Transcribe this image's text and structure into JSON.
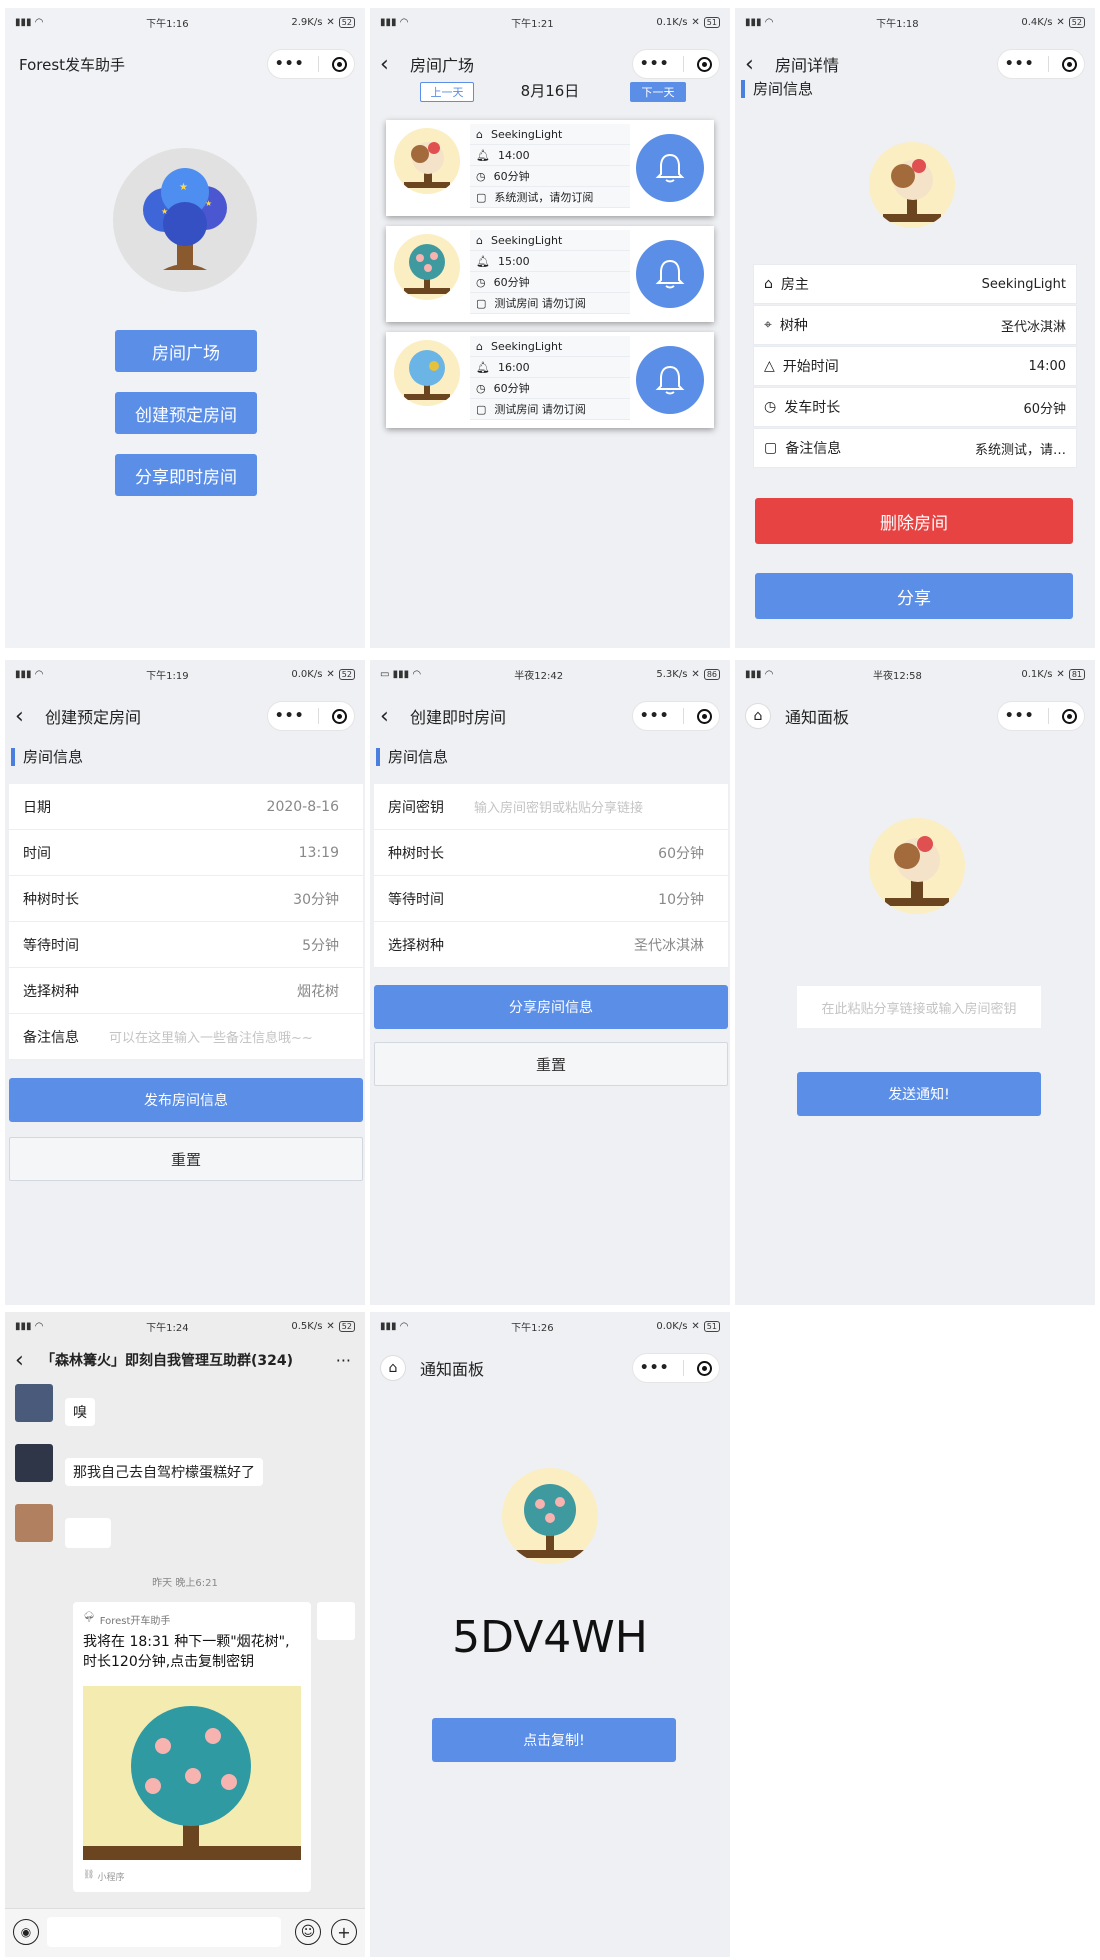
{
  "panels": {
    "home": {
      "status": {
        "time": "下午1:16",
        "speed": "2.9K/s",
        "battery": "52"
      },
      "title": "Forest发车助手",
      "buttons": [
        "房间广场",
        "创建预定房间",
        "分享即时房间"
      ]
    },
    "plaza": {
      "status": {
        "time": "下午1:21",
        "speed": "0.1K/s",
        "battery": "51"
      },
      "title": "房间广场",
      "prev_label": "上一天",
      "date": "8月16日",
      "next_label": "下一天",
      "rooms": [
        {
          "owner": "SeekingLight",
          "time": "14:00",
          "duration": "60分钟",
          "note": "系统测试，请勿订阅",
          "tree": "cream"
        },
        {
          "owner": "SeekingLight",
          "time": "15:00",
          "duration": "60分钟",
          "note": "测试房间 请勿订阅",
          "tree": "flower"
        },
        {
          "owner": "SeekingLight",
          "time": "16:00",
          "duration": "60分钟",
          "note": "测试房间 请勿订阅",
          "tree": "bluebird"
        }
      ]
    },
    "detail": {
      "status": {
        "time": "下午1:18",
        "speed": "0.4K/s",
        "battery": "52"
      },
      "title": "房间详情",
      "section": "房间信息",
      "rows": [
        {
          "label": "房主",
          "value": "SeekingLight",
          "icon": "home-icon"
        },
        {
          "label": "树种",
          "value": "圣代冰淇淋",
          "icon": "tag-icon"
        },
        {
          "label": "开始时间",
          "value": "14:00",
          "icon": "bell-icon"
        },
        {
          "label": "发车时长",
          "value": "60分钟",
          "icon": "clock-icon"
        },
        {
          "label": "备注信息",
          "value": "系统测试，请…",
          "icon": "doc-icon"
        }
      ],
      "delete_label": "删除房间",
      "share_label": "分享"
    },
    "create_sched": {
      "status": {
        "time": "下午1:19",
        "speed": "0.0K/s",
        "battery": "52"
      },
      "title": "创建预定房间",
      "section": "房间信息",
      "rows": [
        {
          "label": "日期",
          "value": "2020-8-16"
        },
        {
          "label": "时间",
          "value": "13:19"
        },
        {
          "label": "种树时长",
          "value": "30分钟"
        },
        {
          "label": "等待时间",
          "value": "5分钟"
        },
        {
          "label": "选择树种",
          "value": "烟花树"
        }
      ],
      "note_label": "备注信息",
      "note_placeholder": "可以在这里输入一些备注信息哦~~",
      "publish_label": "发布房间信息",
      "reset_label": "重置"
    },
    "create_instant": {
      "status": {
        "time": "半夜12:42",
        "speed": "5.3K/s",
        "battery": "86"
      },
      "title": "创建即时房间",
      "section": "房间信息",
      "key_label": "房间密钥",
      "key_placeholder": "输入房间密钥或粘贴分享链接",
      "rows": [
        {
          "label": "种树时长",
          "value": "60分钟"
        },
        {
          "label": "等待时间",
          "value": "10分钟"
        },
        {
          "label": "选择树种",
          "value": "圣代冰淇淋"
        }
      ],
      "share_label": "分享房间信息",
      "reset_label": "重置"
    },
    "notify": {
      "status": {
        "time": "半夜12:58",
        "speed": "0.1K/s",
        "battery": "81"
      },
      "title": "通知面板",
      "input_placeholder": "在此粘贴分享链接或输入房间密钥",
      "send_label": "发送通知!"
    },
    "chat": {
      "status": {
        "time": "下午1:24",
        "speed": "0.5K/s",
        "battery": "52"
      },
      "title": "「森林篝火」即刻自我管理互助群(324)",
      "msg1": "嗅",
      "msg2": "那我自己去自驾柠檬蛋糕好了",
      "timestamp": "昨天 晚上6:21",
      "card_app": "Forest开车助手",
      "card_text": "我将在 18:31 种下一颗\"烟花树\",时长120分钟,点击复制密钥",
      "card_footer": "小程序"
    },
    "notify2": {
      "status": {
        "time": "下午1:26",
        "speed": "0.0K/s",
        "battery": "51"
      },
      "title": "通知面板",
      "code": "5DV4WH",
      "copy_label": "点击复制!"
    }
  }
}
